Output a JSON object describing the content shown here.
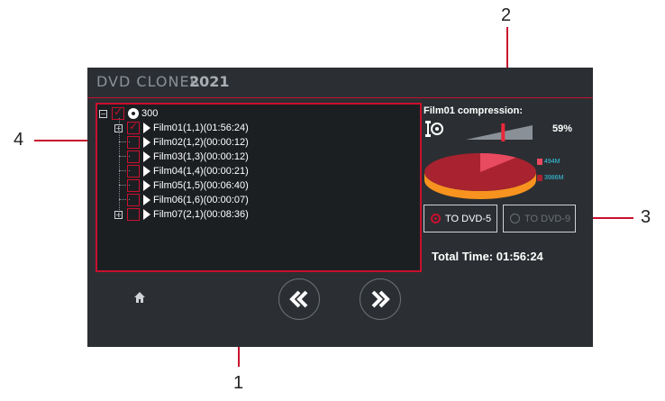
{
  "app": {
    "title": "DVD CLONER",
    "year": "2021"
  },
  "callouts": [
    "1",
    "2",
    "3",
    "4"
  ],
  "tree": {
    "root_label": "300",
    "items": [
      {
        "label": "Film01(1,1)(01:56:24)",
        "checked": true,
        "expandable": true
      },
      {
        "label": "Film02(1,2)(00:00:12)",
        "checked": false,
        "expandable": false
      },
      {
        "label": "Film03(1,3)(00:00:12)",
        "checked": false,
        "expandable": false
      },
      {
        "label": "Film04(1,4)(00:00:21)",
        "checked": false,
        "expandable": false
      },
      {
        "label": "Film05(1,5)(00:06:40)",
        "checked": false,
        "expandable": false
      },
      {
        "label": "Film06(1,6)(00:00:07)",
        "checked": false,
        "expandable": false
      },
      {
        "label": "Film07(2,1)(00:08:36)",
        "checked": false,
        "expandable": true
      }
    ]
  },
  "compression": {
    "label": "Film01 compression:",
    "percent_label": "59%",
    "percent_value": 59
  },
  "pie": {
    "legend": [
      {
        "label": "494M",
        "value": 494,
        "color": "#e84a5f"
      },
      {
        "label": "3986M",
        "value": 3986,
        "color": "#a8232f"
      }
    ]
  },
  "target": {
    "dvd5_label": "TO DVD-5",
    "dvd9_label": "TO DVD-9",
    "selected": "dvd5"
  },
  "total_time_label": "Total Time: 01:56:24",
  "colors": {
    "accent": "#c8102e",
    "window_bg": "#2b2f33",
    "panel_bg": "#1c1f22",
    "pie_side": "#f7931e"
  }
}
